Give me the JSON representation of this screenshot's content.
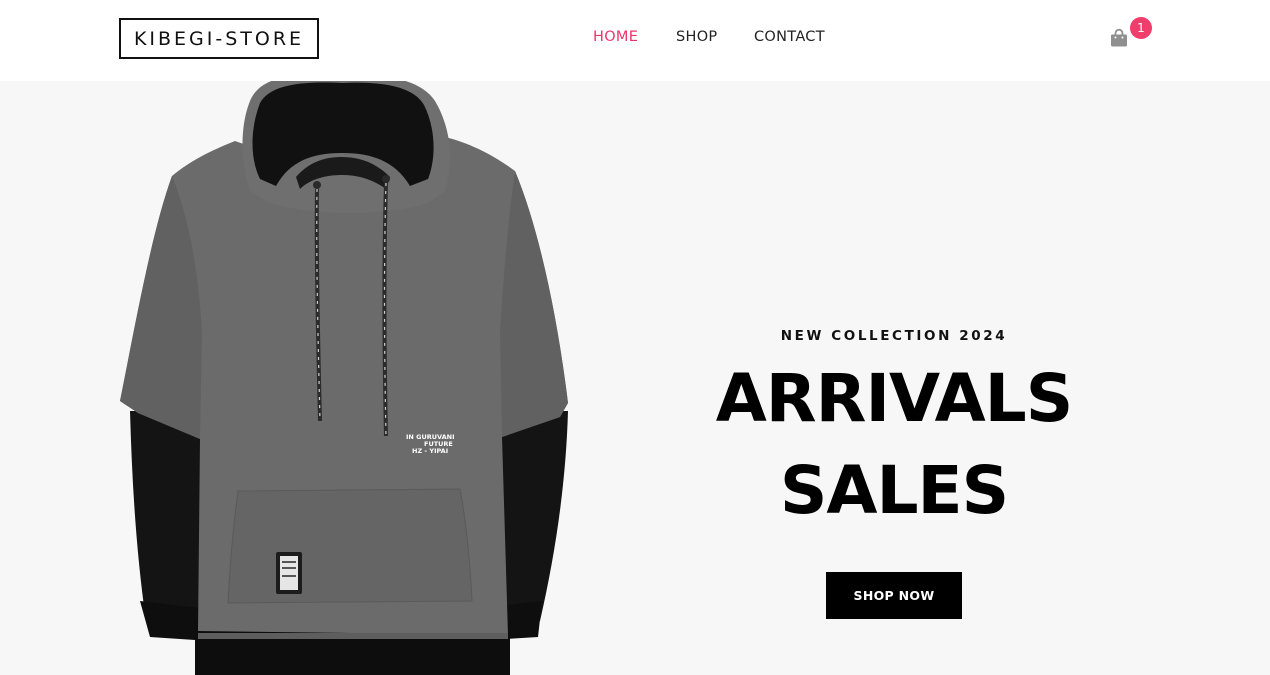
{
  "header": {
    "logo": "KIBEGI-STORE",
    "nav": [
      {
        "label": "HOME",
        "active": true
      },
      {
        "label": "SHOP",
        "active": false
      },
      {
        "label": "CONTACT",
        "active": false
      }
    ],
    "cart": {
      "icon": "shopping-bag-icon",
      "count": "1"
    }
  },
  "hero": {
    "eyebrow": "NEW COLLECTION 2024",
    "headline_line1": "ARRIVALS",
    "headline_line2": "SALES",
    "cta_label": "SHOP NOW",
    "product_image": {
      "subject": "grey hoodie with black layered sleeves",
      "print_text": [
        "IN GURUVANI",
        "FUTURE",
        "HZ - YIPAI"
      ]
    }
  },
  "colors": {
    "accent": "#e8356a",
    "badge": "#ef3e6b",
    "hero_background": "#f7f7f7",
    "button_background": "#000000",
    "hoodie_grey": "#6b6b6b"
  }
}
